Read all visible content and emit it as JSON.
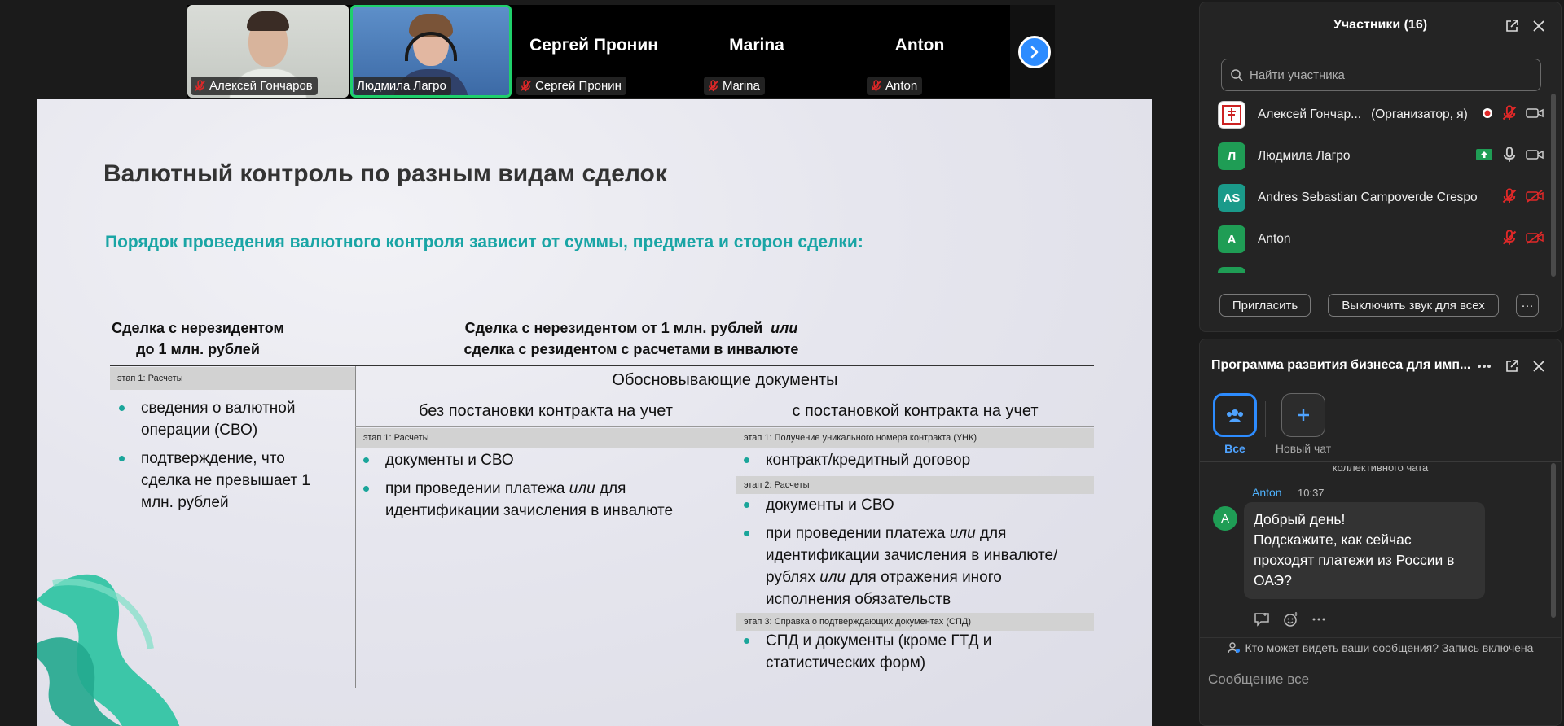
{
  "gallery": {
    "tiles": [
      {
        "name": "Алексей Гончаров",
        "type": "video"
      },
      {
        "name": "Людмила Лагро",
        "type": "video"
      },
      {
        "name": "Сергей Пронин",
        "type": "name"
      },
      {
        "name": "Marina",
        "type": "name"
      },
      {
        "name": "Anton",
        "type": "name"
      }
    ],
    "next_icon": "chevron-right-icon",
    "active_speaker_color": "#1fd06b"
  },
  "slide": {
    "title": "Валютный контроль по разным видам сделок",
    "subtitle": "Порядок проведения валютного контроля зависит от суммы, предмета и сторон сделки:",
    "left_header_line1": "Сделка с нерезидентом",
    "left_header_line2": "до 1 млн. рублей",
    "right_header_line1": "Сделка с нерезидентом от 1 млн. рублей",
    "right_header_italic": "или",
    "right_header_line2": "сделка с резидентом с расчетами в инвалюте",
    "left_stage": "этап 1: Расчеты",
    "left_bullets": [
      "сведения о валютной операции (СВО)",
      "подтверждение, что сделка не превышает 1 млн. рублей"
    ],
    "docs_title": "Обосновывающие документы",
    "mid_title": "без постановки контракта на учет",
    "mid_stage": "этап 1: Расчеты",
    "mid_bullet1": "документы и СВО",
    "mid_bullet2_a": "при проведении платежа ",
    "mid_bullet2_i": "или",
    "mid_bullet2_b": " для идентификации зачисления в инвалюте",
    "right_title": "с постановкой контракта на учет",
    "right_stage1": "этап 1: Получение уникального номера контракта (УНК)",
    "right_stage1_bullet": "контракт/кредитный договор",
    "right_stage2": "этап 2: Расчеты",
    "right_stage2_bullet1": "документы и СВО",
    "right_stage2_bullet2_a": "при проведении платежа ",
    "right_stage2_bullet2_i1": "или",
    "right_stage2_bullet2_b": " для идентификации зачисления в инвалюте/рублях ",
    "right_stage2_bullet2_i2": "или",
    "right_stage2_bullet2_c": " для отражения иного исполнения обязательств",
    "right_stage3": "этап 3: Справка о подтверждающих документах (СПД)",
    "right_stage3_bullet": "СПД и документы (кроме ГТД и статистических форм)",
    "accent_color": "#1aa5a5"
  },
  "participants": {
    "title": "Участники (16)",
    "search_placeholder": "Найти участника",
    "list": [
      {
        "name": "Алексей Гончар...",
        "role": "(Организатор, я)",
        "avatar": "",
        "avatar_color": "#ffffff"
      },
      {
        "name": "Людмила Лагро",
        "role": "",
        "avatar": "Л",
        "avatar_color": "#1f9d55"
      },
      {
        "name": "Andres Sebastian Campoverde Crespo",
        "role": "",
        "avatar": "AS",
        "avatar_color": "#1a9a8a"
      },
      {
        "name": "Anton",
        "role": "",
        "avatar": "A",
        "avatar_color": "#1f9d55"
      }
    ],
    "invite_label": "Пригласить",
    "mute_all_label": "Выключить звук для всех",
    "more_label": "···"
  },
  "chat": {
    "title": "Программа развития бизнеса для имп...",
    "channels": [
      {
        "label": "Все",
        "icon": "group-icon"
      },
      {
        "label": "Новый чат",
        "icon": "plus-icon"
      }
    ],
    "system_text": "коллективного чата",
    "message": {
      "avatar": "A",
      "sender": "Anton",
      "time": "10:37",
      "line1": "Добрый день!",
      "line2": "Подскажите, как сейчас проходят платежи из России в ОАЭ?"
    },
    "notice": "Кто может видеть ваши сообщения? Запись включена",
    "input_placeholder": "Сообщение все"
  }
}
